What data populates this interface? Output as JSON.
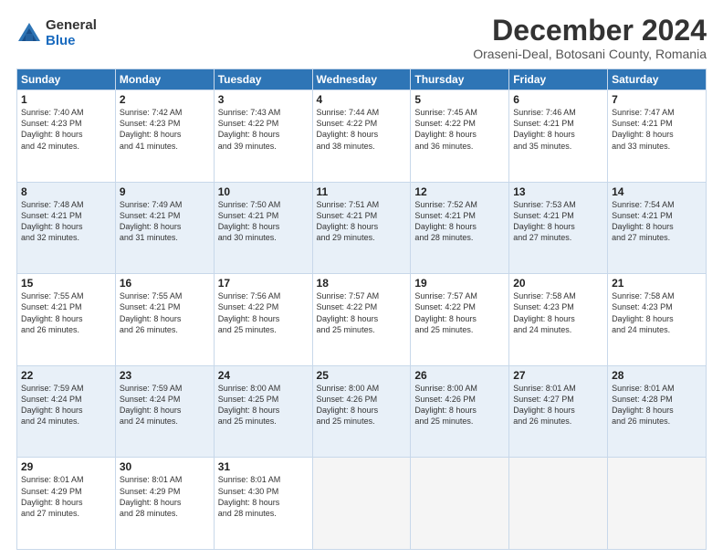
{
  "logo": {
    "general": "General",
    "blue": "Blue"
  },
  "header": {
    "month": "December 2024",
    "location": "Oraseni-Deal, Botosani County, Romania"
  },
  "weekdays": [
    "Sunday",
    "Monday",
    "Tuesday",
    "Wednesday",
    "Thursday",
    "Friday",
    "Saturday"
  ],
  "weeks": [
    [
      {
        "day": "1",
        "info": "Sunrise: 7:40 AM\nSunset: 4:23 PM\nDaylight: 8 hours\nand 42 minutes."
      },
      {
        "day": "2",
        "info": "Sunrise: 7:42 AM\nSunset: 4:23 PM\nDaylight: 8 hours\nand 41 minutes."
      },
      {
        "day": "3",
        "info": "Sunrise: 7:43 AM\nSunset: 4:22 PM\nDaylight: 8 hours\nand 39 minutes."
      },
      {
        "day": "4",
        "info": "Sunrise: 7:44 AM\nSunset: 4:22 PM\nDaylight: 8 hours\nand 38 minutes."
      },
      {
        "day": "5",
        "info": "Sunrise: 7:45 AM\nSunset: 4:22 PM\nDaylight: 8 hours\nand 36 minutes."
      },
      {
        "day": "6",
        "info": "Sunrise: 7:46 AM\nSunset: 4:21 PM\nDaylight: 8 hours\nand 35 minutes."
      },
      {
        "day": "7",
        "info": "Sunrise: 7:47 AM\nSunset: 4:21 PM\nDaylight: 8 hours\nand 33 minutes."
      }
    ],
    [
      {
        "day": "8",
        "info": "Sunrise: 7:48 AM\nSunset: 4:21 PM\nDaylight: 8 hours\nand 32 minutes."
      },
      {
        "day": "9",
        "info": "Sunrise: 7:49 AM\nSunset: 4:21 PM\nDaylight: 8 hours\nand 31 minutes."
      },
      {
        "day": "10",
        "info": "Sunrise: 7:50 AM\nSunset: 4:21 PM\nDaylight: 8 hours\nand 30 minutes."
      },
      {
        "day": "11",
        "info": "Sunrise: 7:51 AM\nSunset: 4:21 PM\nDaylight: 8 hours\nand 29 minutes."
      },
      {
        "day": "12",
        "info": "Sunrise: 7:52 AM\nSunset: 4:21 PM\nDaylight: 8 hours\nand 28 minutes."
      },
      {
        "day": "13",
        "info": "Sunrise: 7:53 AM\nSunset: 4:21 PM\nDaylight: 8 hours\nand 27 minutes."
      },
      {
        "day": "14",
        "info": "Sunrise: 7:54 AM\nSunset: 4:21 PM\nDaylight: 8 hours\nand 27 minutes."
      }
    ],
    [
      {
        "day": "15",
        "info": "Sunrise: 7:55 AM\nSunset: 4:21 PM\nDaylight: 8 hours\nand 26 minutes."
      },
      {
        "day": "16",
        "info": "Sunrise: 7:55 AM\nSunset: 4:21 PM\nDaylight: 8 hours\nand 26 minutes."
      },
      {
        "day": "17",
        "info": "Sunrise: 7:56 AM\nSunset: 4:22 PM\nDaylight: 8 hours\nand 25 minutes."
      },
      {
        "day": "18",
        "info": "Sunrise: 7:57 AM\nSunset: 4:22 PM\nDaylight: 8 hours\nand 25 minutes."
      },
      {
        "day": "19",
        "info": "Sunrise: 7:57 AM\nSunset: 4:22 PM\nDaylight: 8 hours\nand 25 minutes."
      },
      {
        "day": "20",
        "info": "Sunrise: 7:58 AM\nSunset: 4:23 PM\nDaylight: 8 hours\nand 24 minutes."
      },
      {
        "day": "21",
        "info": "Sunrise: 7:58 AM\nSunset: 4:23 PM\nDaylight: 8 hours\nand 24 minutes."
      }
    ],
    [
      {
        "day": "22",
        "info": "Sunrise: 7:59 AM\nSunset: 4:24 PM\nDaylight: 8 hours\nand 24 minutes."
      },
      {
        "day": "23",
        "info": "Sunrise: 7:59 AM\nSunset: 4:24 PM\nDaylight: 8 hours\nand 24 minutes."
      },
      {
        "day": "24",
        "info": "Sunrise: 8:00 AM\nSunset: 4:25 PM\nDaylight: 8 hours\nand 25 minutes."
      },
      {
        "day": "25",
        "info": "Sunrise: 8:00 AM\nSunset: 4:26 PM\nDaylight: 8 hours\nand 25 minutes."
      },
      {
        "day": "26",
        "info": "Sunrise: 8:00 AM\nSunset: 4:26 PM\nDaylight: 8 hours\nand 25 minutes."
      },
      {
        "day": "27",
        "info": "Sunrise: 8:01 AM\nSunset: 4:27 PM\nDaylight: 8 hours\nand 26 minutes."
      },
      {
        "day": "28",
        "info": "Sunrise: 8:01 AM\nSunset: 4:28 PM\nDaylight: 8 hours\nand 26 minutes."
      }
    ],
    [
      {
        "day": "29",
        "info": "Sunrise: 8:01 AM\nSunset: 4:29 PM\nDaylight: 8 hours\nand 27 minutes."
      },
      {
        "day": "30",
        "info": "Sunrise: 8:01 AM\nSunset: 4:29 PM\nDaylight: 8 hours\nand 28 minutes."
      },
      {
        "day": "31",
        "info": "Sunrise: 8:01 AM\nSunset: 4:30 PM\nDaylight: 8 hours\nand 28 minutes."
      },
      {
        "day": "",
        "info": ""
      },
      {
        "day": "",
        "info": ""
      },
      {
        "day": "",
        "info": ""
      },
      {
        "day": "",
        "info": ""
      }
    ]
  ]
}
